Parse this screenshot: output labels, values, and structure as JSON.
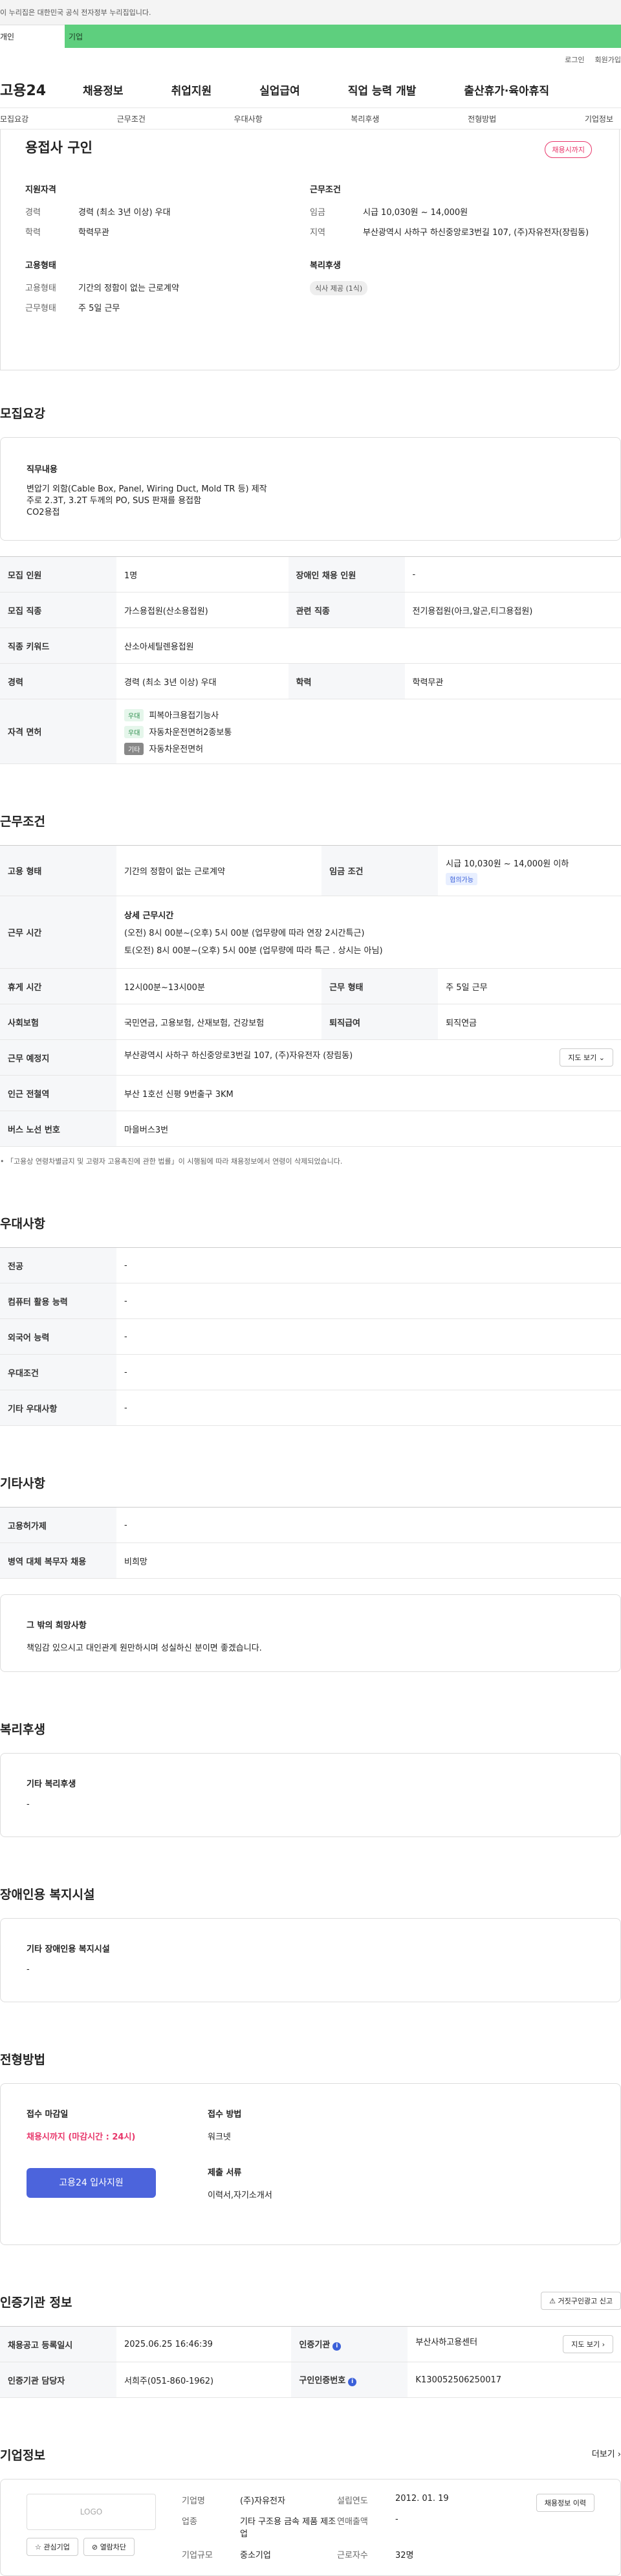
{
  "gov_banner": "이 누리집은 대한민국 공식 전자정부 누리집입니다.",
  "top_tabs": {
    "individual": "개인",
    "company": "기업"
  },
  "util": {
    "login": "로그인",
    "signup": "회원가입"
  },
  "gnb": {
    "logo": "고용24",
    "menu": [
      "채용정보",
      "취업지원",
      "실업급여",
      "직업 능력 개발",
      "출산휴가·육아휴직"
    ]
  },
  "subnav": [
    "모집요강",
    "근무조건",
    "우대사항",
    "복리후생",
    "전형방법",
    "기업정보"
  ],
  "summary": {
    "title": "용접사 구인",
    "badge": "채용시까지",
    "qualification": {
      "heading": "지원자격",
      "rows": [
        {
          "k": "경력",
          "v": "경력 (최소 3년 이상) 우대"
        },
        {
          "k": "학력",
          "v": "학력무관"
        }
      ]
    },
    "conditions": {
      "heading": "근무조건",
      "rows": [
        {
          "k": "임금",
          "v": "시급 10,030원 ~ 14,000원"
        },
        {
          "k": "지역",
          "v": "부산광역시 사하구 하신중앙로3번길 107, (주)자유전자(장림동)"
        }
      ]
    },
    "employment": {
      "heading": "고용형태",
      "rows": [
        {
          "k": "고용형태",
          "v": "기간의 정함이 없는 근로계약"
        },
        {
          "k": "근무형태",
          "v": "주 5일 근무"
        }
      ]
    },
    "welfare": {
      "heading": "복리후생",
      "pill": "식사 제공 (1식)"
    }
  },
  "recruit": {
    "title": "모집요강",
    "duty_heading": "직무내용",
    "duty_lines": [
      "변압기 외함(Cable Box, Panel, Wiring Duct, Mold TR 등) 제작",
      "주로 2.3T, 3.2T 두께의 PO, SUS 판재를 용접함",
      "CO2용접"
    ],
    "rows": {
      "count_h": "모집 인원",
      "count_v": "1명",
      "disabled_h": "장애인 채용 인원",
      "disabled_v": "-",
      "job_h": "모집 직종",
      "job_v": "가스용접원(산소용접원)",
      "rel_h": "관련 직종",
      "rel_v": "전기용접원(아크,알곤,티그용접원)",
      "kw_h": "직종 키워드",
      "kw_v": "산소아세틸렌용접원",
      "career_h": "경력",
      "career_v": "경력 (최소 3년 이상) 우대",
      "edu_h": "학력",
      "edu_v": "학력무관",
      "lic_h": "자격 면허",
      "licenses": [
        {
          "tag": "우대",
          "name": "피복아크용접기능사"
        },
        {
          "tag": "우대",
          "name": "자동차운전면허2종보통"
        },
        {
          "tag": "기타",
          "name": "자동차운전면허"
        }
      ]
    }
  },
  "work": {
    "title": "근무조건",
    "emp_h": "고용 형태",
    "emp_v": "기간의 정함이 없는 근로계약",
    "wage_h": "임금 조건",
    "wage_v": "시급 10,030원 ~ 14,000원 이하",
    "wage_tag": "협의가능",
    "time_h": "근무 시간",
    "time_detail_h": "상세 근무시간",
    "time_lines": [
      "(오전) 8시 00분~(오후) 5시 00분 (업무량에 따라 연장 2시간특근)",
      "토(오전) 8시 00분~(오후) 5시 00분 (업무량에 따라 특근 . 상시는 아님)"
    ],
    "break_h": "휴게 시간",
    "break_v": "12시00분~13시00분",
    "shift_h": "근무 형태",
    "shift_v": "주 5일 근무",
    "ins_h": "사회보험",
    "ins_v": "국민연금, 고용보험, 산재보험, 건강보험",
    "ret_h": "퇴직급여",
    "ret_v": "퇴직연금",
    "place_h": "근무 예정지",
    "place_v": "부산광역시 사하구 하신중앙로3번길 107, (주)자유전자 (장림동)",
    "map_btn": "지도 보기",
    "station_h": "인근 전철역",
    "station_v": "부산 1호선 신평 9번출구 3KM",
    "bus_h": "버스 노선 번호",
    "bus_v": "마을버스3번",
    "note": "「고용상 연령차별금지 및 고령자 고용촉진에 관한 법률」이 시행됨에 따라 채용정보에서 연령이 삭제되었습니다."
  },
  "pref": {
    "title": "우대사항",
    "rows": [
      {
        "k": "전공",
        "v": "-"
      },
      {
        "k": "컴퓨터 활용 능력",
        "v": "-"
      },
      {
        "k": "외국어 능력",
        "v": "-"
      },
      {
        "k": "우대조건",
        "v": "-"
      },
      {
        "k": "기타 우대사항",
        "v": "-"
      }
    ]
  },
  "etc": {
    "title": "기타사항",
    "rows": [
      {
        "k": "고용허가제",
        "v": "-"
      },
      {
        "k": "병역 대체 복무자 채용",
        "v": "비희망"
      }
    ],
    "hope_h": "그 밖의 희망사항",
    "hope_v": "책임감 있으시고 대인관계 원만하시며 성실하신 분이면 좋겠습니다."
  },
  "welfare": {
    "title": "복리후생",
    "h": "기타 복리후생",
    "v": "-"
  },
  "disabled": {
    "title": "장애인용 복지시설",
    "h": "기타 장애인용 복지시설",
    "v": "-"
  },
  "selection": {
    "title": "전형방법",
    "deadline_h": "접수 마감일",
    "deadline_v": "채용시까지 (마감시간 : 24시)",
    "apply_btn": "고용24 입사지원",
    "method_h": "접수 방법",
    "method_v": "워크넷",
    "docs_h": "제출 서류",
    "docs_v": "이력서,자기소개서"
  },
  "cert": {
    "title": "인증기관 정보",
    "report_btn": "거짓구인광고 신고",
    "reg_h": "채용공고 등록일시",
    "reg_v": "2025.06.25 16:46:39",
    "org_h": "인증기관",
    "org_v": "부산사하고용센터",
    "map_btn": "지도 보기",
    "mgr_h": "인증기관 담당자",
    "mgr_v": "서희주(051-860-1962)",
    "no_h": "구인인증번호",
    "no_v": "K130052506250017",
    "info_glyph": "i"
  },
  "company": {
    "title": "기업정보",
    "more": "더보기",
    "logo": "LOGO",
    "fav_btn": "관심기업",
    "block_btn": "열람차단",
    "name_h": "기업명",
    "name_v": "(주)자유전자",
    "found_h": "설립연도",
    "found_v": "2012. 01. 19",
    "ind_h": "업종",
    "ind_v": "기타 구조용 금속 제품 제조업",
    "sales_h": "연매출액",
    "sales_v": "-",
    "scale_h": "기업규모",
    "scale_v": "중소기업",
    "emp_h": "근로자수",
    "emp_v": "32명",
    "history_btn": "채용정보 이력"
  }
}
